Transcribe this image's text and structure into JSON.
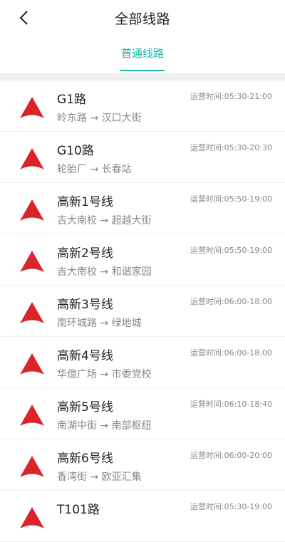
{
  "header": {
    "title": "全部线路",
    "back_icon": "chevron-left-icon"
  },
  "tabs": [
    {
      "label": "普通线路",
      "active": true
    }
  ],
  "colors": {
    "accent": "#1bb6a8",
    "icon_red": "#d9252a"
  },
  "routes": [
    {
      "name": "G1路",
      "route": "岭东路 → 汉口大街",
      "hours": "运营时间:05:30-21:00"
    },
    {
      "name": "G10路",
      "route": "轮胎厂 → 长春站",
      "hours": "运营时间:05:30-20:30"
    },
    {
      "name": "高新1号线",
      "route": "吉大南校 → 超越大街",
      "hours": "运营时间:05:50-19:00"
    },
    {
      "name": "高新2号线",
      "route": "吉大南校 → 和谐家园",
      "hours": "运营时间:05:50-19:00"
    },
    {
      "name": "高新3号线",
      "route": "南环城路 → 绿地城",
      "hours": "运营时间:06:00-18:00"
    },
    {
      "name": "高新4号线",
      "route": "华億广场 → 市委党校",
      "hours": "运营时间:06:00-18:00"
    },
    {
      "name": "高新5号线",
      "route": "南湖中街 → 南部枢纽",
      "hours": "运营时间:06:10-18:40"
    },
    {
      "name": "高新6号线",
      "route": "香湾街 → 欧亚汇集",
      "hours": "运营时间:06:00-20:00"
    },
    {
      "name": "T101路",
      "route": "",
      "hours": "运营时间:05:30-19:00"
    }
  ]
}
